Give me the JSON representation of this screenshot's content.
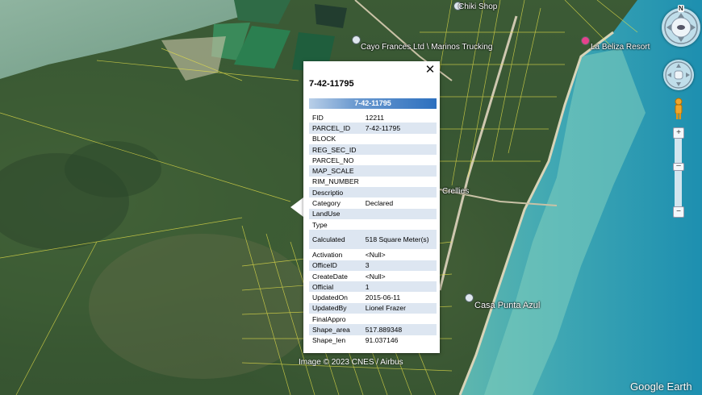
{
  "map": {
    "labels": {
      "chiki_shop": "Chiki Shop",
      "trucking": "Cayo Frances Ltd \\ Marinos Trucking",
      "beliza": "La Beliza Resort",
      "crellies": "Crellies",
      "casa": "Casa Punta Azul"
    },
    "attribution": "Image © 2023 CNES / Airbus",
    "logo": "Google Earth",
    "compass_north": "N"
  },
  "popup": {
    "title": "7-42-11795",
    "header": "7-42-11795",
    "close_icon": "close-icon",
    "attributes": [
      {
        "key": "FID",
        "value": "12211"
      },
      {
        "key": "PARCEL_ID",
        "value": "7-42-11795"
      },
      {
        "key": "BLOCK",
        "value": ""
      },
      {
        "key": "REG_SEC_ID",
        "value": ""
      },
      {
        "key": "PARCEL_NO",
        "value": ""
      },
      {
        "key": "MAP_SCALE",
        "value": ""
      },
      {
        "key": "RIM_NUMBER",
        "value": ""
      },
      {
        "key": "Descriptio",
        "value": ""
      },
      {
        "key": "Category",
        "value": "Declared"
      },
      {
        "key": "LandUse",
        "value": ""
      },
      {
        "key": "Type",
        "value": ""
      },
      {
        "key": "Calculated",
        "value": "518 Square Meter(s)"
      },
      {
        "key": "Activation",
        "value": "<Null>"
      },
      {
        "key": "OfficeID",
        "value": "3"
      },
      {
        "key": "CreateDate",
        "value": "<Null>"
      },
      {
        "key": "Official",
        "value": "1"
      },
      {
        "key": "UpdatedOn",
        "value": "2015-06-11"
      },
      {
        "key": "UpdatedBy",
        "value": "Lionel Frazer"
      },
      {
        "key": "FinalAppro",
        "value": ""
      },
      {
        "key": "Shape_area",
        "value": "517.889348"
      },
      {
        "key": "Shape_len",
        "value": "91.037146"
      }
    ]
  },
  "controls": {
    "zoom_in": "+",
    "zoom_out": "−",
    "zoom_level": 0.4
  }
}
